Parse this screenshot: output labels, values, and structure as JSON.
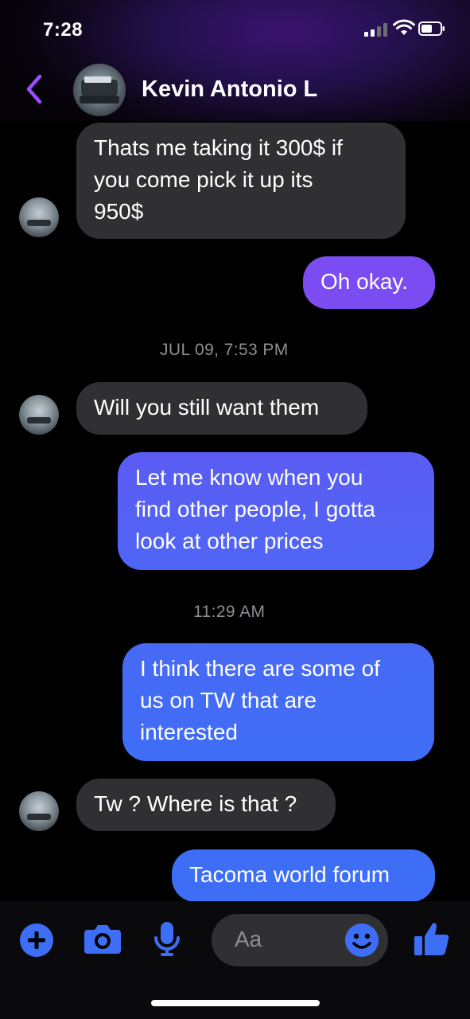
{
  "status_bar": {
    "time": "7:28"
  },
  "header": {
    "contact_name": "Kevin Antonio L"
  },
  "messages": [
    {
      "text": "Thats me taking it 300$ if\nyou come pick it up its\n950$"
    },
    {
      "text": "Oh okay."
    },
    {
      "text": "Will you still want them"
    },
    {
      "text": "Let me know when you\nfind other people, I gotta\nlook at other prices"
    },
    {
      "text": "I think there are some of\nus on TW that are\ninterested"
    },
    {
      "text": "Tw ? Where is that ?"
    },
    {
      "text": "Tacoma world forum"
    }
  ],
  "timestamps": [
    "JUL 09, 7:53 PM",
    "11:29 AM"
  ],
  "composer": {
    "placeholder": "Aa"
  },
  "colors": {
    "accent": "#3d6ef5",
    "outgoing_top": "#7a4cf2",
    "outgoing_bottom": "#3f6ef6",
    "incoming": "#303033",
    "back_chevron": "#9b4dff"
  },
  "icons": [
    "plus-icon",
    "camera-icon",
    "microphone-icon",
    "emoji-icon",
    "thumbs-up-icon",
    "back-chevron-icon"
  ]
}
